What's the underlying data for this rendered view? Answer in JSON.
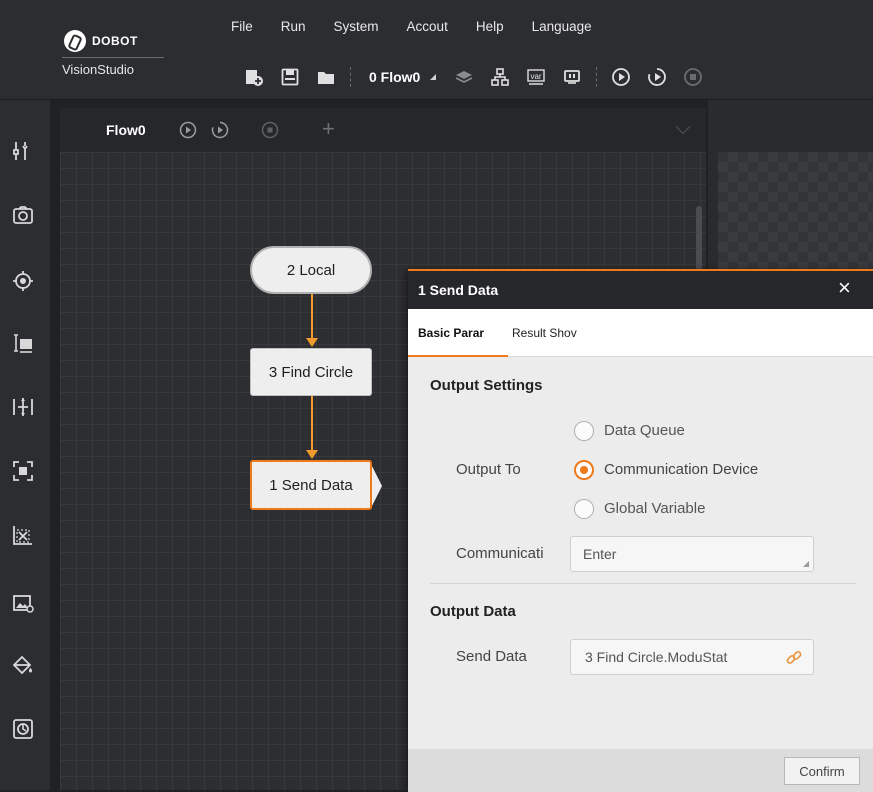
{
  "app": {
    "brand": "DOBOT",
    "name": "VisionStudio"
  },
  "menu": [
    "File",
    "Run",
    "System",
    "Accout",
    "Help",
    "Language"
  ],
  "toolbar": {
    "flow_select": "0 Flow0",
    "icons": [
      "new-solution-icon",
      "save-icon",
      "open-folder-icon",
      "layers-icon",
      "hierarchy-icon",
      "var-icon",
      "io-icon",
      "run-once-icon",
      "run-continuous-icon",
      "stop-icon"
    ]
  },
  "sidebar_icons": [
    "tools-icon",
    "camera-icon",
    "locate-icon",
    "measure-icon",
    "calibrate-icon",
    "recognize-icon",
    "defect-icon",
    "image-process-icon",
    "color-icon",
    "logic-icon"
  ],
  "flow": {
    "tab_label": "Flow0",
    "nodes": [
      {
        "label": "2 Local"
      },
      {
        "label": "3 Find Circle"
      },
      {
        "label": "1 Send Data"
      }
    ]
  },
  "dialog": {
    "title": "1 Send Data",
    "close": "×",
    "tabs": [
      "Basic Parar",
      "Result Shov"
    ],
    "output_settings": {
      "heading": "Output Settings",
      "output_to_label": "Output To",
      "options": [
        "Data Queue",
        "Communication Device",
        "Global Variable"
      ],
      "selected": "Communication Device",
      "comm_label": "Communicati",
      "comm_value": "Enter"
    },
    "output_data": {
      "heading": "Output Data",
      "send_label": "Send Data",
      "send_value": "3 Find Circle.ModuStat"
    },
    "confirm": "Confirm"
  },
  "colors": {
    "accent": "#f07a1a",
    "topbar": "#2b2d30",
    "canvas": "#2d2e31",
    "dialog_bg": "#ececec"
  }
}
